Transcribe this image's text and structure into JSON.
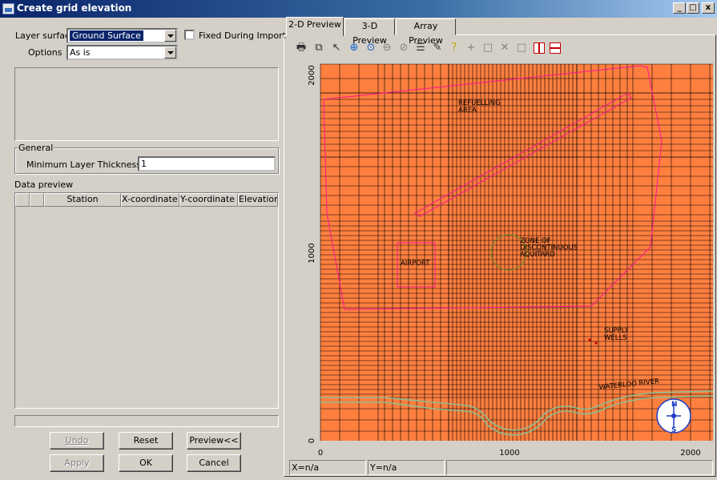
{
  "window": {
    "title": "Create grid elevation",
    "controls": [
      "_",
      "□",
      "x"
    ]
  },
  "layer": {
    "surface_label": "Layer surface",
    "surface_value": "Ground Surface",
    "fixed_label": "Fixed During Import",
    "fixed_checked": false,
    "options_label": "Options",
    "options_value": "As is"
  },
  "general": {
    "title": "General",
    "min_thickness_label": "Minimum Layer Thickness [m]",
    "min_thickness_value": "1"
  },
  "data_preview": {
    "label": "Data preview",
    "columns": [
      "",
      "",
      "Station",
      "X-coordinate [r",
      "Y-coordinate [r",
      "Elevation [m]"
    ]
  },
  "buttons": {
    "undo": "Undo",
    "reset": "Reset",
    "preview": "Preview<<",
    "apply": "Apply",
    "ok": "OK",
    "cancel": "Cancel"
  },
  "tabs": [
    "2-D Preview",
    "3-D Preview",
    "Array Preview"
  ],
  "toolbar_icons": [
    "printer-icon",
    "copy-icon",
    "arrow-pointer-icon",
    "zoom-in-icon",
    "zoom-window-icon",
    "zoom-out-icon",
    "zoom-reset-icon",
    "list-icon",
    "properties-icon",
    "help-icon",
    "add-point-icon",
    "new-icon",
    "delete-icon",
    "blank-icon",
    "vertical-line-icon",
    "horizontal-line-icon"
  ],
  "map": {
    "x_ticks": [
      "0",
      "1000",
      "2000"
    ],
    "y_ticks": [
      "0",
      "1000",
      "2000"
    ],
    "labels": {
      "refuelling": [
        "REFUELLING",
        "AREA"
      ],
      "zone": [
        "ZONE OF",
        "DISCONTINUOUS",
        "AQUITARD"
      ],
      "airport": "AIRPORT",
      "supply": [
        "SUPPLY",
        "WELLS"
      ],
      "river": "WATERLOO RIVER"
    },
    "compass": [
      "N",
      "S"
    ],
    "colors": {
      "fill": "#ff7f3f",
      "grid": "#000000",
      "boundary": "#ff1493",
      "river": "#8fbc8f",
      "zone": "#6b8e23"
    }
  },
  "status": {
    "x": "X=n/a",
    "y": "Y=n/a"
  }
}
